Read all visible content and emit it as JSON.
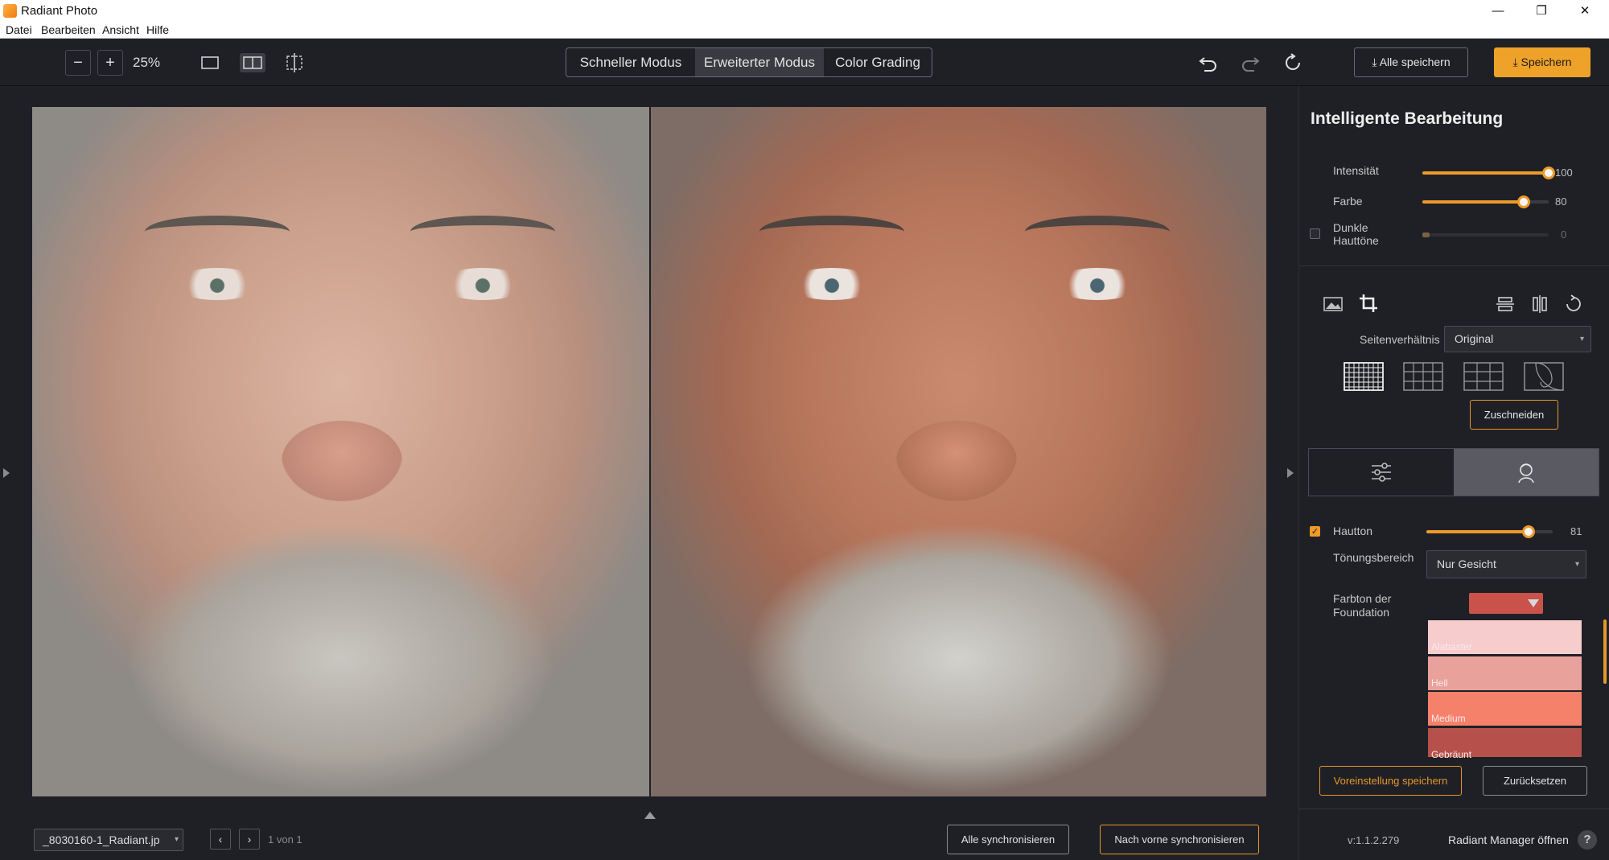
{
  "window": {
    "title": "Radiant Photo",
    "minimize": "—",
    "maximize": "❐",
    "close": "✕"
  },
  "menu": [
    "Datei",
    "Bearbeiten",
    "Ansicht",
    "Hilfe"
  ],
  "toolbar": {
    "zoom_out": "−",
    "zoom_in": "+",
    "zoom_level": "25%",
    "modes": [
      "Schneller Modus",
      "Erweiterter Modus",
      "Color Grading"
    ],
    "active_mode": "Erweiterter Modus",
    "save_all": "Alle speichern",
    "save": "Speichern"
  },
  "panel": {
    "title": "Intelligente Bearbeitung",
    "sliders": [
      {
        "label": "Intensität",
        "value": 100,
        "max": 100
      },
      {
        "label": "Farbe",
        "value": 80,
        "max": 100
      },
      {
        "label": "Dunkle Hauttöne",
        "value": 0,
        "max": 100,
        "checked": false
      }
    ],
    "aspect_label": "Seitenverhältnis",
    "aspect_value": "Original",
    "crop_button": "Zuschneiden",
    "skin": {
      "label": "Hautton",
      "value": 81,
      "max": 100,
      "checked": true
    },
    "toning_label": "Tönungsbereich",
    "toning_value": "Nur Gesicht",
    "foundation_label": "Farbton der Foundation",
    "foundation_color": "#c9524a",
    "swatches": [
      {
        "label": "Alabaster",
        "color": "#f6cccc"
      },
      {
        "label": "Hell",
        "color": "#e9a19c"
      },
      {
        "label": "Medium",
        "color": "#f5816b"
      },
      {
        "label": "Gebräunt",
        "color": "#b5514a"
      }
    ],
    "save_preset": "Voreinstellung speichern",
    "reset": "Zurücksetzen",
    "version": "v:1.1.2.279",
    "manager": "Radiant Manager öffnen"
  },
  "bottom": {
    "file_name": "_8030160-1_Radiant.jp",
    "page_info": "1 von 1",
    "sync_all": "Alle synchronisieren",
    "sync_front": "Nach vorne synchronisieren"
  },
  "colors": {
    "accent": "#ee9a2a",
    "background": "#1f2026"
  }
}
